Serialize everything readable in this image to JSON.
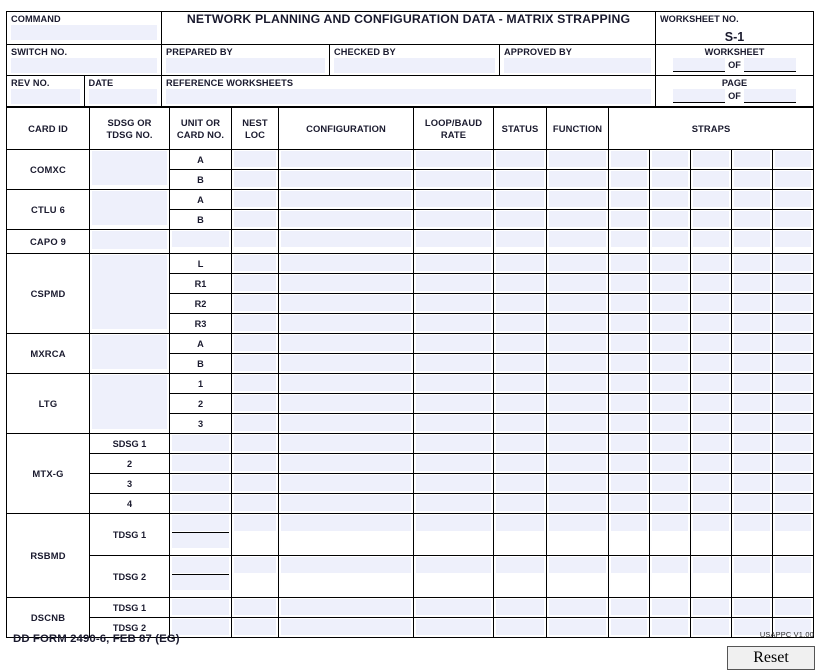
{
  "header": {
    "command_label": "COMMAND",
    "title": "NETWORK PLANNING AND CONFIGURATION DATA - MATRIX STRAPPING",
    "worksheet_no_label": "WORKSHEET NO.",
    "worksheet_no_value": "S-1",
    "switch_no_label": "SWITCH NO.",
    "prepared_by_label": "PREPARED BY",
    "checked_by_label": "CHECKED BY",
    "approved_by_label": "APPROVED BY",
    "worksheet_label": "WORKSHEET",
    "page_label": "PAGE",
    "of_label": "OF",
    "rev_no_label": "REV NO.",
    "date_label": "DATE",
    "reference_worksheets_label": "REFERENCE WORKSHEETS"
  },
  "columns": {
    "card_id": "CARD ID",
    "sdsg_or_tdsg_no": "SDSG OR\nTDSG NO.",
    "sdsg_line1": "SDSG OR",
    "sdsg_line2": "TDSG NO.",
    "unit_line1": "UNIT OR",
    "unit_line2": "CARD NO.",
    "nest_line1": "NEST",
    "nest_line2": "LOC",
    "configuration": "CONFIGURATION",
    "loop_line1": "LOOP/BAUD",
    "loop_line2": "RATE",
    "status": "STATUS",
    "function": "FUNCTION",
    "straps": "STRAPS"
  },
  "rows": [
    {
      "card_id": "COMXC",
      "units": [
        "A",
        "B"
      ]
    },
    {
      "card_id": "CTLU 6",
      "units": [
        "A",
        "B"
      ]
    },
    {
      "card_id": "CAPO 9",
      "units": [
        ""
      ]
    },
    {
      "card_id": "CSPMD",
      "units": [
        "L",
        "R1",
        "R2",
        "R3"
      ]
    },
    {
      "card_id": "MXRCA",
      "units": [
        "A",
        "B"
      ]
    },
    {
      "card_id": "LTG",
      "units": [
        "1",
        "2",
        "3"
      ]
    },
    {
      "card_id": "MTX-G",
      "sdsg_labels": [
        "SDSG 1",
        "2",
        "3",
        "4"
      ]
    },
    {
      "card_id": "RSBMD",
      "sdsg_labels": [
        "TDSG 1",
        "TDSG 2"
      ]
    },
    {
      "card_id": "DSCNB",
      "sdsg_labels": [
        "TDSG 1",
        "TDSG 2"
      ]
    }
  ],
  "footer": {
    "form_number": "DD FORM 2490-6, FEB 87 (EG)",
    "usappc": "USAPPC V1.00",
    "reset_label": "Reset"
  },
  "colors": {
    "field_background": "#eef0fb",
    "border": "#000000",
    "text": "#1a1a2e"
  }
}
